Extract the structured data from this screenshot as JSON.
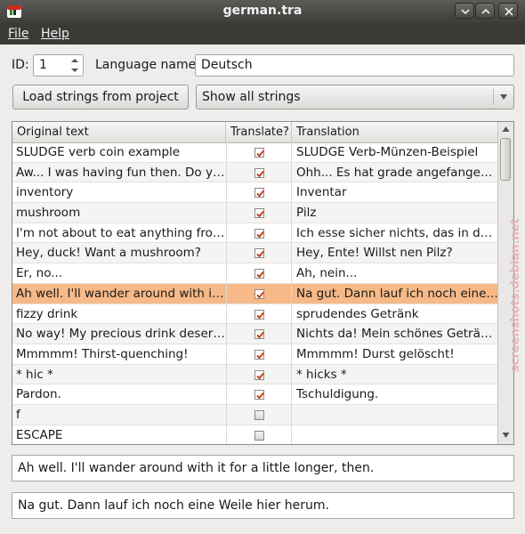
{
  "window": {
    "title": "german.tra",
    "controls": [
      "minimize-icon",
      "maximize-icon",
      "close-icon"
    ]
  },
  "menu": {
    "file": "File",
    "help": "Help"
  },
  "form": {
    "id_label": "ID:",
    "id_value": "1",
    "language_label": "Language name:",
    "language_value": "Deutsch",
    "load_button": "Load strings from project",
    "filter_selected": "Show all strings"
  },
  "table": {
    "headers": [
      "Original text",
      "Translate?",
      "Translation"
    ],
    "rows": [
      {
        "original": "SLUDGE verb coin example",
        "translate": true,
        "translation": "SLUDGE Verb-Münzen-Beispiel"
      },
      {
        "original": "Aw... I was having fun then. Do yo...",
        "translate": true,
        "translation": "Ohh... Es hat grade angefangen, ..."
      },
      {
        "original": "inventory",
        "translate": true,
        "translation": "Inventar"
      },
      {
        "original": "mushroom",
        "translate": true,
        "translation": "Pilz"
      },
      {
        "original": "I'm not about to eat anything from...",
        "translate": true,
        "translation": "Ich esse sicher nichts, das in der ..."
      },
      {
        "original": "Hey, duck! Want a mushroom?",
        "translate": true,
        "translation": "Hey, Ente! Willst nen Pilz?"
      },
      {
        "original": "Er, no...",
        "translate": true,
        "translation": "Ah, nein..."
      },
      {
        "original": "Ah well. I'll wander around with it ...",
        "translate": true,
        "translation": "Na gut. Dann lauf ich noch eine ...",
        "selected": true
      },
      {
        "original": "fizzy drink",
        "translate": true,
        "translation": "sprudendes Getränk"
      },
      {
        "original": "No way! My precious drink deserv...",
        "translate": true,
        "translation": "Nichts da! Mein schönes Getränk..."
      },
      {
        "original": "Mmmmm! Thirst-quenching!",
        "translate": true,
        "translation": "Mmmmm! Durst gelöscht!"
      },
      {
        "original": "* hic *",
        "translate": true,
        "translation": "* hicks *"
      },
      {
        "original": "Pardon.",
        "translate": true,
        "translation": "Tschuldigung."
      },
      {
        "original": "f",
        "translate": false,
        "translation": ""
      },
      {
        "original": "ESCAPE",
        "translate": false,
        "translation": ""
      }
    ]
  },
  "detail": {
    "original_text": "Ah well. I'll wander around with it for a little longer, then.",
    "translated_text": "Na gut. Dann lauf ich noch eine Weile hier herum."
  },
  "watermark": "screenshots.debian.net",
  "colors": {
    "selection": "#f6b987",
    "check": "#c8431c",
    "titlebar": "#4a4946",
    "menubar": "#3b3a37"
  }
}
